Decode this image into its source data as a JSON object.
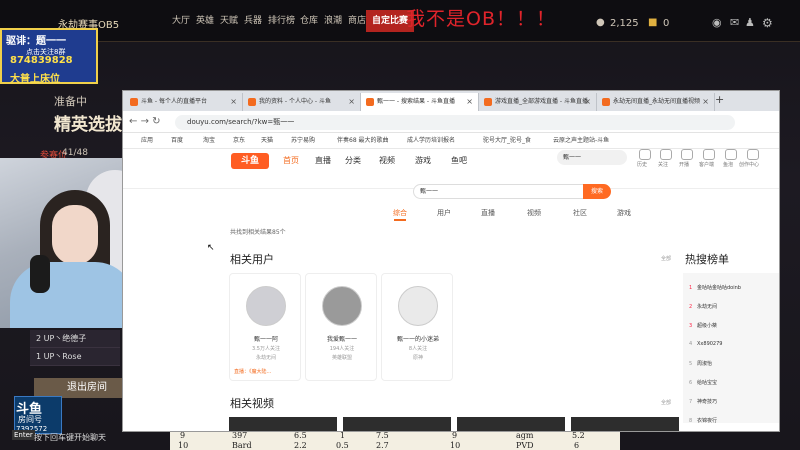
{
  "game": {
    "lobby_title": "永劫赛事OB5",
    "tabs": [
      "大厅",
      "英雄",
      "天赋",
      "兵器",
      "排行榜",
      "仓库",
      "浪潮",
      "商店",
      "自定比赛"
    ],
    "red_note": "我不是OB！！！",
    "coin": "2,125",
    "gold": "0",
    "overlay_line1": "驱诽：题一一",
    "overlay_line2": "点击关注8群",
    "overlay_qq": "874839828",
    "overlay_line3": "大普上床位",
    "prep": "准备中",
    "elite": "精英选拔",
    "progress_label": "参赛位",
    "progress_count": "41/48",
    "players": [
      "2  UP丶绝德子",
      "1  UP丶Rose"
    ],
    "exit_room": "退出房间",
    "enter": "Enter",
    "chat_hint": "按下回车键开始聊天",
    "douyu": "斗鱼",
    "room_label": "房间号",
    "room_id": "7392572"
  },
  "score_table": {
    "row1": [
      "9",
      "397",
      "6.5",
      "1",
      "7.5",
      "9",
      "agm",
      "5.2"
    ],
    "row2": [
      "10",
      "Bard",
      "2.2",
      "0.5",
      "2.7",
      "10",
      "PVD",
      "6"
    ]
  },
  "browser": {
    "tabs": [
      "斗鱼 - 每个人的直播平台",
      "我的资料 - 个人中心 - 斗鱼",
      "甄一一 - 搜索结果 - 斗鱼直播",
      "游戏直播_全部游戏直播 - 斗鱼直播",
      "永劫无间直播_永劫无间直播视频"
    ],
    "url": "douyu.com/search/?kw=甄一一",
    "bookmarks": [
      "应用",
      "百度",
      "淘宝",
      "京东",
      "天猫",
      "苏宁易购",
      "伴奏68 最大的歌曲",
      "成人学历培训报名",
      "驼号大厅_驼号_食",
      "云原之声主题站-斗鱼"
    ],
    "nav": [
      "首页",
      "直播",
      "分类",
      "视频",
      "游戏",
      "鱼吧"
    ],
    "site_search": "甄一一",
    "right_icons": [
      "历史",
      "关注",
      "开播",
      "客户端",
      "鱼泡",
      "创作中心"
    ],
    "search_value": "甄一一",
    "search_button": "搜索",
    "search_tabs": [
      "综合",
      "用户",
      "直播",
      "视频",
      "社区",
      "游戏"
    ],
    "result_count": "共找到相关结果85个",
    "section_users": "相关用户",
    "all": "全部",
    "users": [
      {
        "name": "甄一一阿",
        "fans": "3.5万人关注",
        "cat": "永劫无间",
        "live": "直播：《魔大陆..."
      },
      {
        "name": "我爱甄一一",
        "fans": "194人关注",
        "cat": "英雄联盟",
        "live": ""
      },
      {
        "name": "甄一一的小迷弟",
        "fans": "8人关注",
        "cat": "原神",
        "live": ""
      }
    ],
    "section_videos": "相关视频",
    "hot_title": "热搜榜单",
    "hot": [
      {
        "n": "1",
        "t": "金咕咕金咕咕doinb"
      },
      {
        "n": "2",
        "t": "永劫无间"
      },
      {
        "n": "3",
        "t": "超级小桀"
      },
      {
        "n": "4",
        "t": "Xx890279"
      },
      {
        "n": "5",
        "t": "周淑怡"
      },
      {
        "n": "6",
        "t": "给咕宝宝"
      },
      {
        "n": "7",
        "t": "神奇技巧"
      },
      {
        "n": "8",
        "t": "衣锦夜行"
      }
    ]
  }
}
